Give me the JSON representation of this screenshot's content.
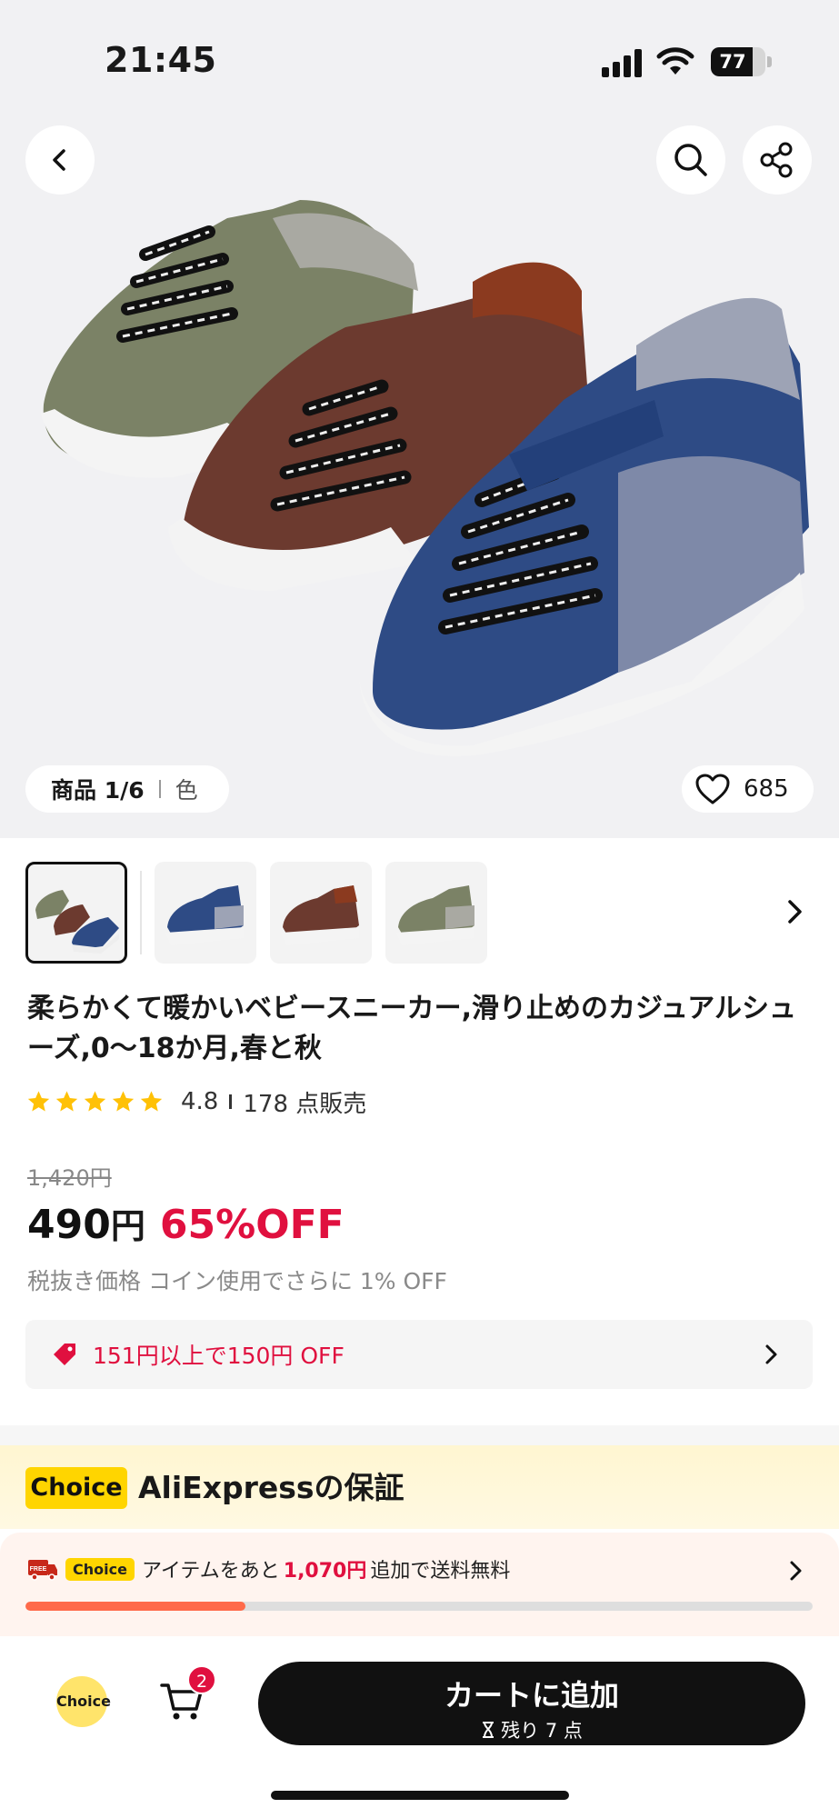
{
  "status_bar": {
    "time": "21:45",
    "battery": "77",
    "battery_level": 0.77
  },
  "gallery": {
    "position_label": "商品 1/6",
    "color_label": "色",
    "favorites": "685"
  },
  "product": {
    "title": "柔らかくて暖かいベビースニーカー,滑り止めのカジュアルシューズ,0～18か月,春と秋",
    "rating": "4.8",
    "sold": "178 点販売",
    "stars": 5,
    "original_price": "1,420円",
    "price": "490",
    "price_unit": "円",
    "discount": "65%OFF",
    "tax_note": "税抜き価格 コイン使用でさらに 1% OFF"
  },
  "coupon": {
    "text": "151円以上で150円 OFF"
  },
  "guarantee": {
    "badge": "Choice",
    "title": "AliExpressの保証"
  },
  "shipping": {
    "free_label": "FREE",
    "choice_label": "Choice",
    "prefix": "アイテムをあと",
    "amount": "1,070円",
    "suffix": "追加で送料無料",
    "progress": 0.28
  },
  "bottom_bar": {
    "choice_label": "Choice",
    "cart_count": "2",
    "add_to_cart": "カートに追加",
    "stock": "残り 7 点"
  },
  "colors": {
    "accent_red": "#e0103f",
    "choice_yellow": "#ffd500",
    "progress": "#ff6a4a"
  }
}
